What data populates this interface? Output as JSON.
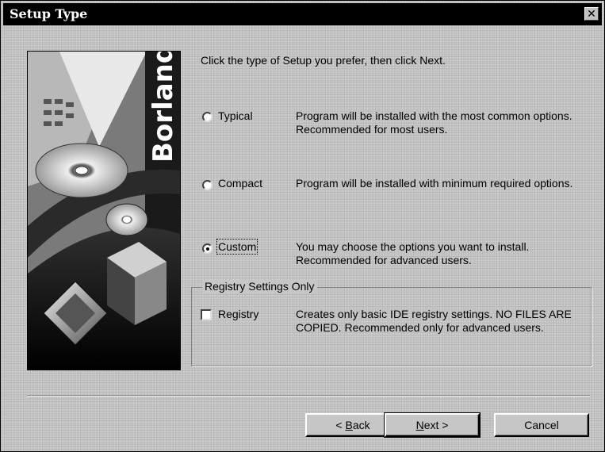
{
  "window": {
    "title": "Setup Type",
    "close_glyph": "✕"
  },
  "intro": "Click the type of Setup you prefer, then click Next.",
  "artwork": {
    "brand": "Borland"
  },
  "options": [
    {
      "label": "Typical",
      "description": "Program will be installed with the most common options. Recommended for most users.",
      "checked": false
    },
    {
      "label": "Compact",
      "description": "Program will be installed with minimum required options.",
      "checked": false
    },
    {
      "label": "Custom",
      "description": "You may choose the options you want to install. Recommended for advanced users.",
      "checked": true
    }
  ],
  "registry_group": {
    "legend": "Registry Settings Only",
    "checkbox_label": "Registry",
    "checked": false,
    "description": "Creates only basic IDE registry settings. NO FILES ARE COPIED. Recommended only for advanced users."
  },
  "buttons": {
    "back": {
      "prefix": "< ",
      "mnemonic": "B",
      "rest": "ack"
    },
    "next": {
      "mnemonic": "N",
      "rest": "ext >"
    },
    "cancel": "Cancel"
  },
  "icons": {
    "close": "close-icon",
    "radio": "radio-button",
    "checkbox": "checkbox"
  }
}
